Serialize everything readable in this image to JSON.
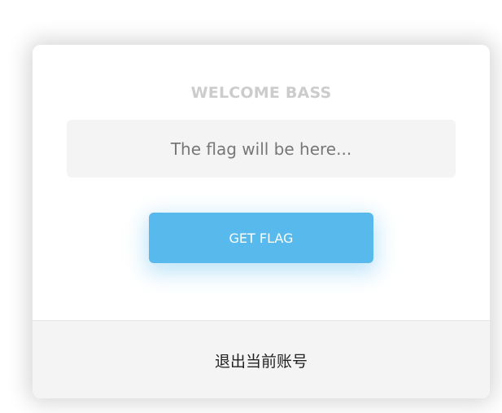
{
  "card": {
    "welcome_text": "WELCOME BASS",
    "flag_placeholder": "The flag will be here...",
    "get_flag_label": "GET FLAG",
    "logout_label": "退出当前账号"
  },
  "colors": {
    "accent": "#57b9ec",
    "panel_gray": "#f4f4f4",
    "welcome_gray": "#cccccc"
  }
}
